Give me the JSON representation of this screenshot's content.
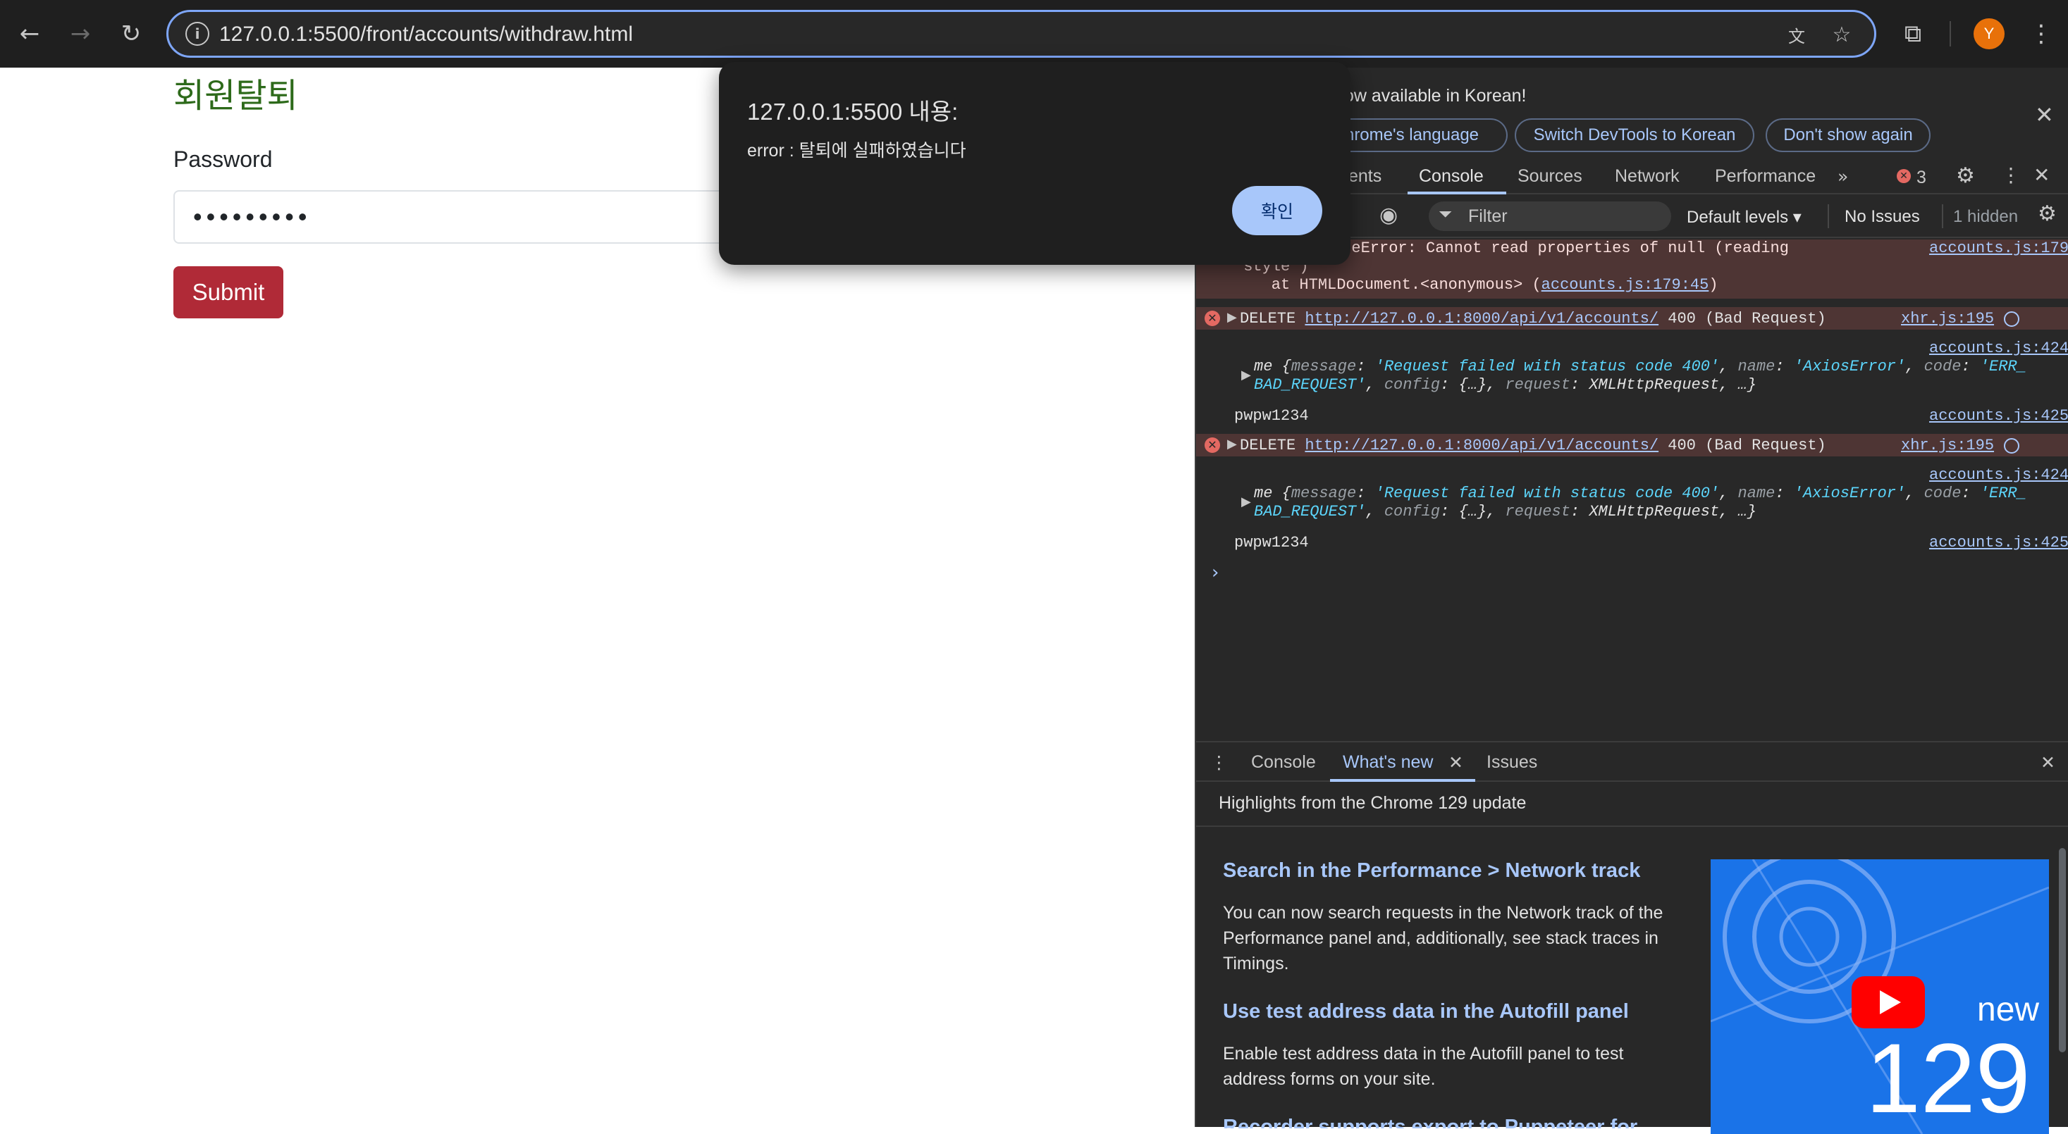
{
  "browser": {
    "url": "127.0.0.1:5500/front/accounts/withdraw.html",
    "avatar_initial": "Y",
    "icons": [
      "back-arrow-icon",
      "forward-arrow-icon",
      "reload-icon",
      "site-info-icon",
      "translate-icon",
      "star-icon",
      "extensions-icon",
      "more-vert-icon"
    ]
  },
  "page": {
    "title": "회원탈퇴",
    "password_label": "Password",
    "password_value": "•••••••••",
    "submit_label": "Submit"
  },
  "dialog": {
    "title": "127.0.0.1:5500 내용:",
    "message": "error : 탈퇴에 실패하였습니다",
    "ok_label": "확인"
  },
  "devtools": {
    "banner_text": "ow available in Korean!",
    "banner_chips": [
      "hrome's language",
      "Switch DevTools to Korean",
      "Don't show again"
    ],
    "tabs": [
      "ents",
      "Console",
      "Sources",
      "Network",
      "Performance"
    ],
    "error_count": "3",
    "filter_placeholder": "Filter",
    "default_levels": "Default levels ▾",
    "no_issues": "No Issues",
    "hidden": "1 hidden",
    "console": {
      "typeerror_line1": "ypeError: Cannot read properties of null (reading",
      "typeerror_line2": "'style')",
      "typeerror_line3a": "    at HTMLDocument.<anonymous> (",
      "typeerror_line3_link": "accounts.js:179:45",
      "typeerror_line3b": ")",
      "typeerror_src": "accounts.js:179",
      "delete1_text": "DELETE ",
      "delete_url": "http://127.0.0.1:8000/api/v1/accounts/",
      "delete_status": " 400 (Bad Request)",
      "delete_src": "xhr.js:195",
      "me_src": "accounts.js:424",
      "me_prefix": "me {",
      "me_k1": "message",
      "me_v1": "'Request failed with status code 400'",
      "me_k2": "name",
      "me_v2": "'AxiosError'",
      "me_k3": "code",
      "me_v3a": "'ERR_",
      "me_v3b": "BAD_REQUEST'",
      "me_k4": "config",
      "me_v4": "{…}",
      "me_k5": "request",
      "me_v5": "XMLHttpRequest, …}",
      "pw_log": "pwpw1234",
      "pw_src": "accounts.js:425"
    },
    "drawer": {
      "tabs": [
        "Console",
        "What's new",
        "Issues"
      ],
      "highlights": "Highlights from the Chrome 129 update",
      "items": [
        {
          "title": "Search in the Performance > Network track",
          "body": "You can now search requests in the Network track of the Performance panel and, additionally, see stack traces in Timings."
        },
        {
          "title": "Use test address data in the Autofill panel",
          "body": "Enable test address data in the Autofill panel to test address forms on your site."
        },
        {
          "title": "Recorder supports export to Puppeteer for"
        }
      ],
      "video_label_new": "new",
      "video_label_num": "129"
    }
  }
}
